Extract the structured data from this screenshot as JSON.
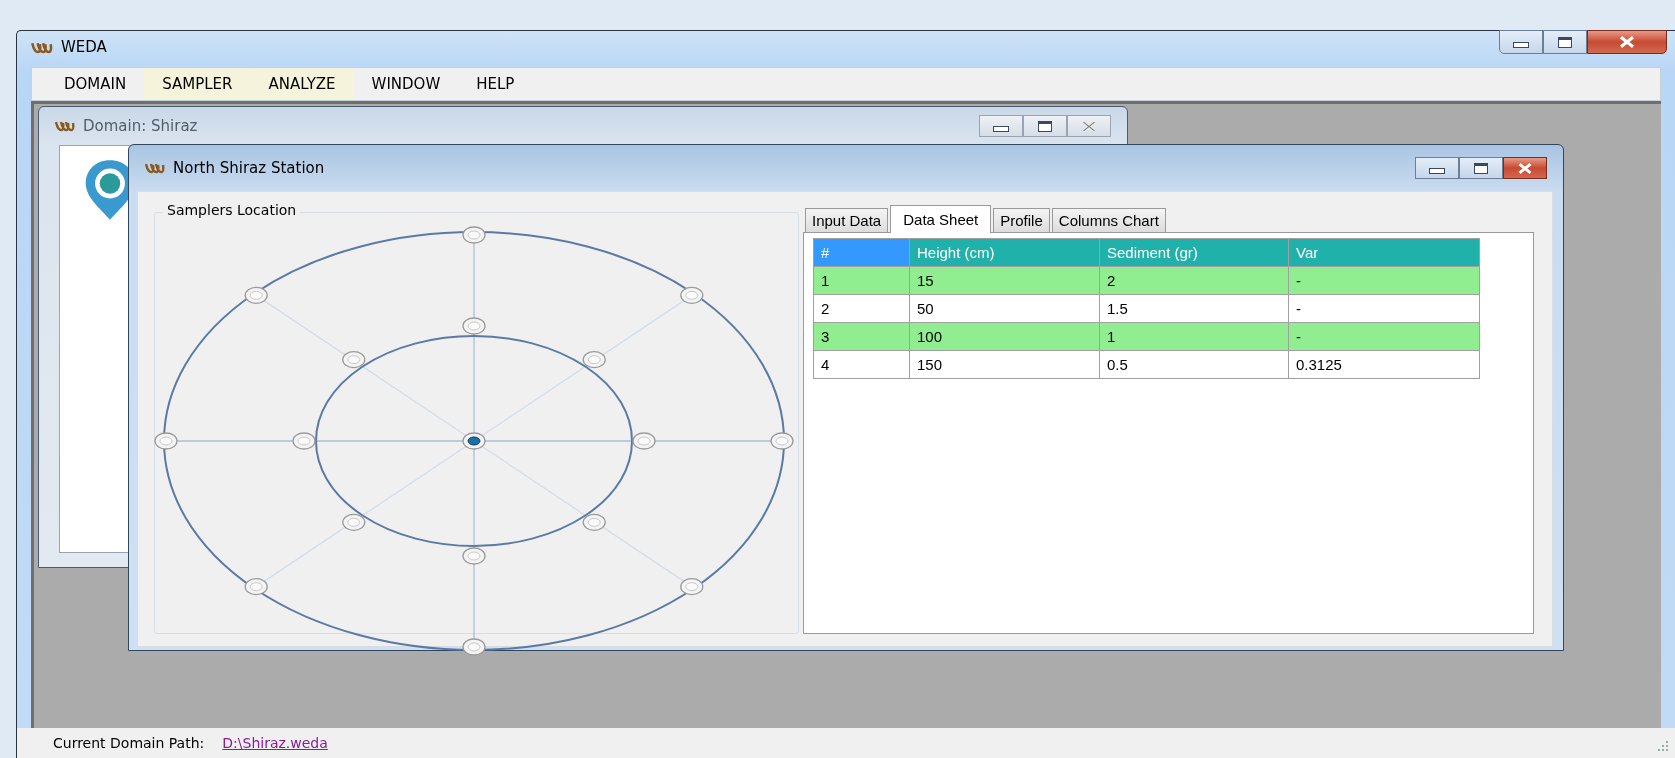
{
  "window": {
    "title": "WEDA"
  },
  "menu": [
    {
      "label": "DOMAIN",
      "highlighted": false
    },
    {
      "label": "SAMPLER",
      "highlighted": true
    },
    {
      "label": "ANALYZE",
      "highlighted": true
    },
    {
      "label": "WINDOW",
      "highlighted": false
    },
    {
      "label": "HELP",
      "highlighted": false
    }
  ],
  "domain_window": {
    "title": "Domain: Shiraz"
  },
  "station_window": {
    "title": "North Shiraz Station",
    "samplers_location": {
      "title": "Samplers Location",
      "center": {
        "selected": true
      },
      "rings": [
        {
          "samplers": [
            {
              "selected": false
            },
            {
              "selected": false
            },
            {
              "selected": false
            },
            {
              "selected": false
            },
            {
              "selected": false
            },
            {
              "selected": false
            },
            {
              "selected": false
            },
            {
              "selected": false
            }
          ]
        },
        {
          "samplers": [
            {
              "selected": false
            },
            {
              "selected": false
            },
            {
              "selected": false
            },
            {
              "selected": false
            },
            {
              "selected": false
            },
            {
              "selected": false
            },
            {
              "selected": false
            },
            {
              "selected": false
            }
          ]
        }
      ]
    },
    "tabs": [
      {
        "label": "Input Data",
        "selected": false
      },
      {
        "label": "Data Sheet",
        "selected": true
      },
      {
        "label": "Profile",
        "selected": false
      },
      {
        "label": "Columns Chart",
        "selected": false
      }
    ],
    "table": {
      "columns": [
        "#",
        "Height (cm)",
        "Sediment (gr)",
        "Var"
      ],
      "rows": [
        [
          "1",
          "15",
          "2",
          "-"
        ],
        [
          "2",
          "50",
          "1.5",
          "-"
        ],
        [
          "3",
          "100",
          "1",
          "-"
        ],
        [
          "4",
          "150",
          "0.5",
          "0.3125"
        ]
      ]
    }
  },
  "status_bar": {
    "label": "Current Domain Path:",
    "path": "D:\\Shiraz.weda"
  }
}
